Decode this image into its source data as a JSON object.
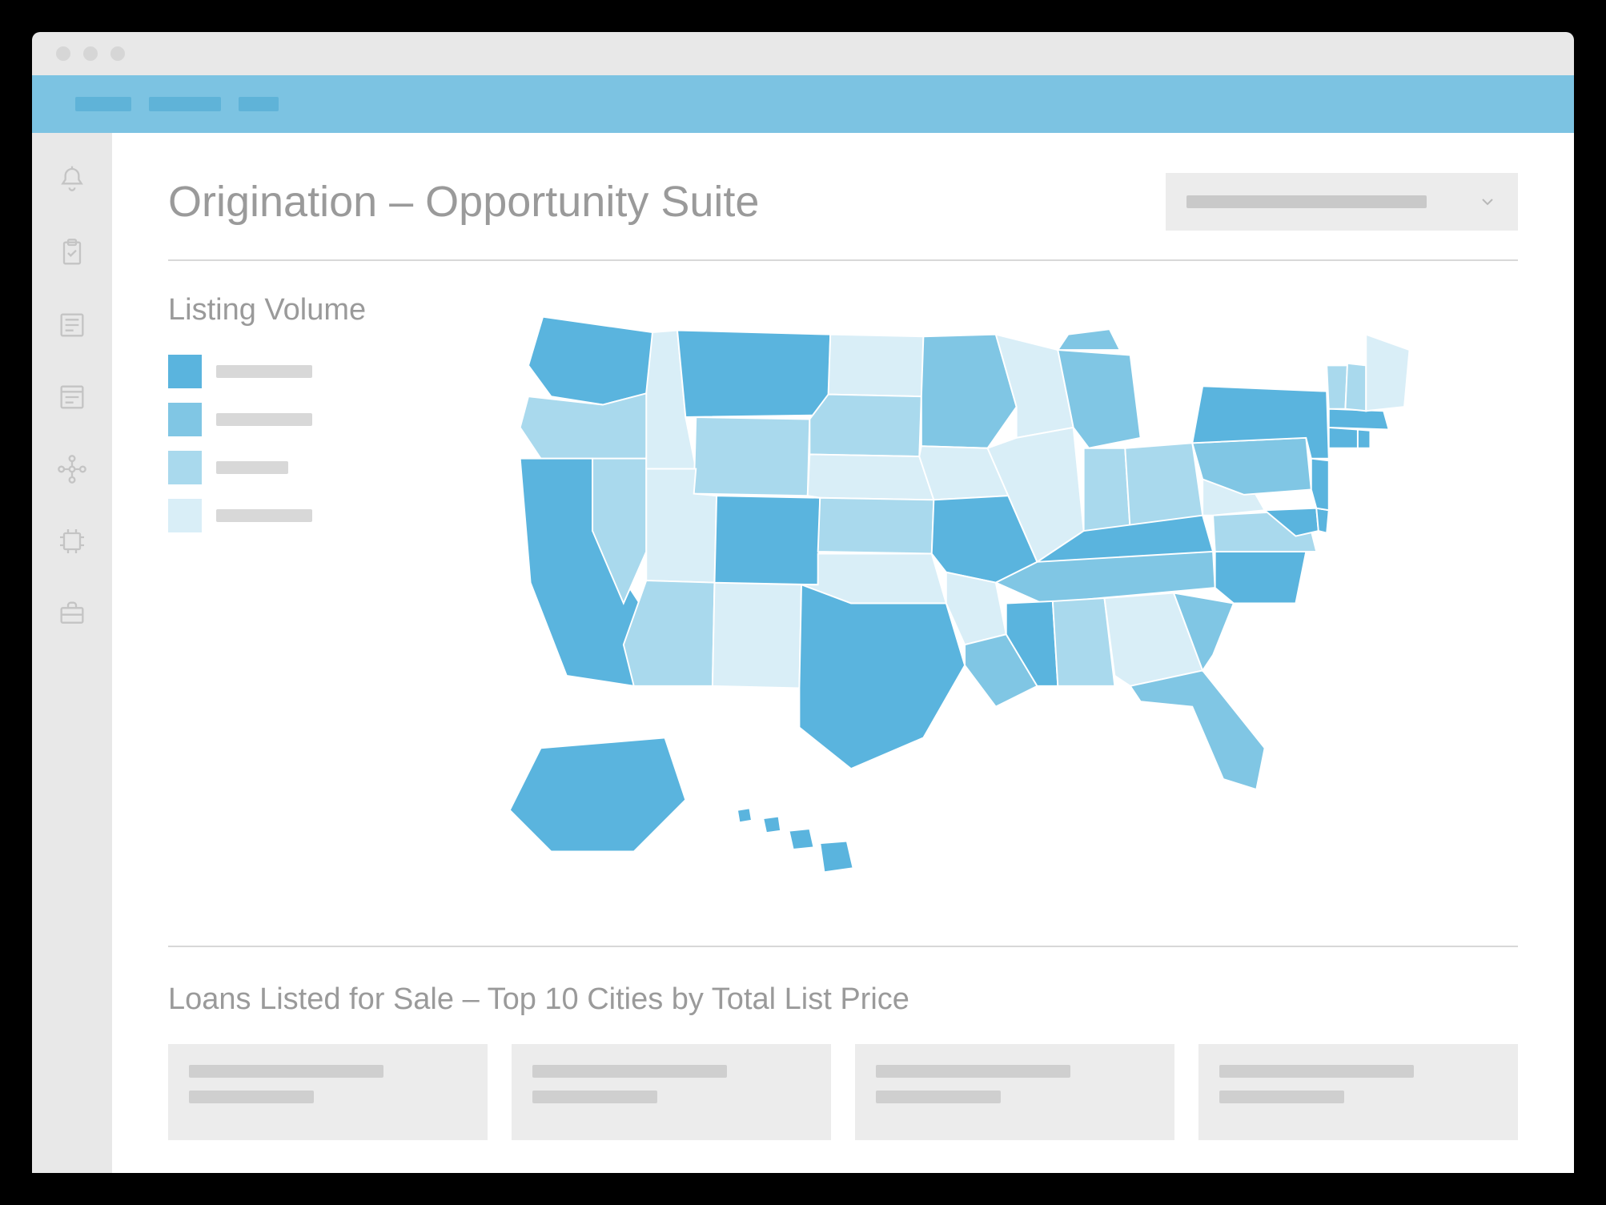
{
  "page": {
    "title": "Origination – Opportunity Suite"
  },
  "map_section": {
    "title": "Listing Volume",
    "legend": [
      {
        "color": "#5ab4de",
        "label": ""
      },
      {
        "color": "#80c6e4",
        "label": ""
      },
      {
        "color": "#a9d9ed",
        "label": ""
      },
      {
        "color": "#d9eef7",
        "label": ""
      }
    ]
  },
  "lower_section": {
    "title": "Loans Listed for Sale – Top 10 Cities by Total List Price"
  },
  "colors": {
    "shade1": "#5ab4de",
    "shade2": "#80c6e4",
    "shade3": "#a9d9ed",
    "shade4": "#d9eef7",
    "stroke": "#ffffff"
  },
  "chart_data": {
    "type": "choropleth-map",
    "region": "US-states",
    "title": "Listing Volume",
    "legend_bins": 4,
    "values_by_state_bin": {
      "WA": 1,
      "OR": 3,
      "CA": 1,
      "NV": 3,
      "ID": 4,
      "MT": 1,
      "WY": 3,
      "UT": 4,
      "AZ": 3,
      "NM": 4,
      "CO": 1,
      "TX": 1,
      "OK": 4,
      "KS": 3,
      "NE": 4,
      "SD": 3,
      "ND": 4,
      "MN": 2,
      "IA": 4,
      "MO": 1,
      "AR": 4,
      "LA": 2,
      "MS": 1,
      "AL": 3,
      "GA": 4,
      "FL": 2,
      "SC": 2,
      "NC": 1,
      "TN": 2,
      "KY": 1,
      "WV": 4,
      "VA": 3,
      "MD": 1,
      "DE": 1,
      "NJ": 1,
      "PA": 2,
      "NY": 1,
      "CT": 1,
      "RI": 1,
      "MA": 1,
      "VT": 3,
      "NH": 3,
      "ME": 4,
      "OH": 3,
      "IN": 3,
      "IL": 4,
      "MI": 2,
      "WI": 4,
      "AK": 1,
      "HI": 1
    }
  }
}
